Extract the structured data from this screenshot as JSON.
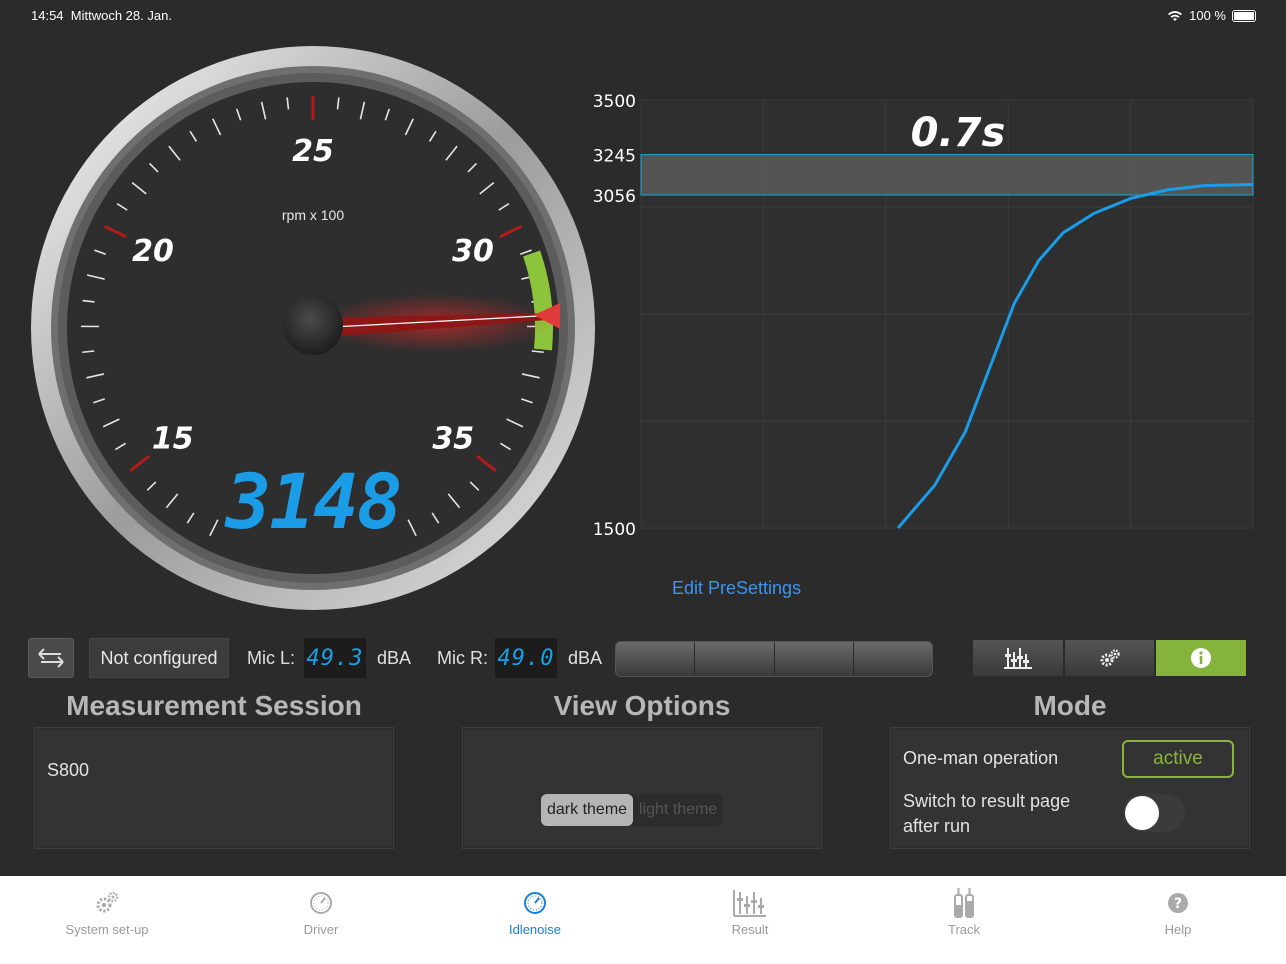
{
  "status": {
    "time": "14:54",
    "date": "Mittwoch 28. Jan.",
    "battery": "100 %"
  },
  "gauge": {
    "unit_label": "rpm x 100",
    "scale_labels": [
      "15",
      "20",
      "25",
      "30",
      "35"
    ],
    "readout": "3148",
    "value_rpm": 3148,
    "green_zone": [
      3056,
      3245
    ]
  },
  "chart_data": {
    "type": "line",
    "title": "0.7s",
    "y_ticks": [
      "3500",
      "3245",
      "3056",
      "1500"
    ],
    "ylim": [
      1500,
      3500
    ],
    "band": [
      3056,
      3245
    ],
    "grid": true,
    "series": [
      {
        "values": [
          [
            0.42,
            1500
          ],
          [
            0.48,
            1700
          ],
          [
            0.53,
            1950
          ],
          [
            0.57,
            2250
          ],
          [
            0.61,
            2550
          ],
          [
            0.65,
            2750
          ],
          [
            0.69,
            2880
          ],
          [
            0.74,
            2970
          ],
          [
            0.8,
            3040
          ],
          [
            0.86,
            3080
          ],
          [
            0.92,
            3100
          ],
          [
            1.0,
            3105
          ]
        ]
      }
    ]
  },
  "edit_link": "Edit PreSettings",
  "controls": {
    "not_configured": "Not configured",
    "mic_l_label": "Mic L:",
    "mic_l_value": "49.3",
    "mic_r_label": "Mic R:",
    "mic_r_value": "49.0",
    "unit": "dBA"
  },
  "sections": {
    "session_title": "Measurement Session",
    "session_value": "S800",
    "view_title": "View Options",
    "theme_dark": "dark theme",
    "theme_light": "light theme",
    "mode_title": "Mode",
    "one_man": "One-man operation",
    "active": "active",
    "switch_result": "Switch to result page after run"
  },
  "tabs": [
    {
      "label": "System set-up",
      "icon": "gears-icon"
    },
    {
      "label": "Driver",
      "icon": "gauge-icon"
    },
    {
      "label": "Idlenoise",
      "icon": "gauge-icon"
    },
    {
      "label": "Result",
      "icon": "sliders-icon"
    },
    {
      "label": "Track",
      "icon": "tubes-icon"
    },
    {
      "label": "Help",
      "icon": "help-icon"
    }
  ]
}
